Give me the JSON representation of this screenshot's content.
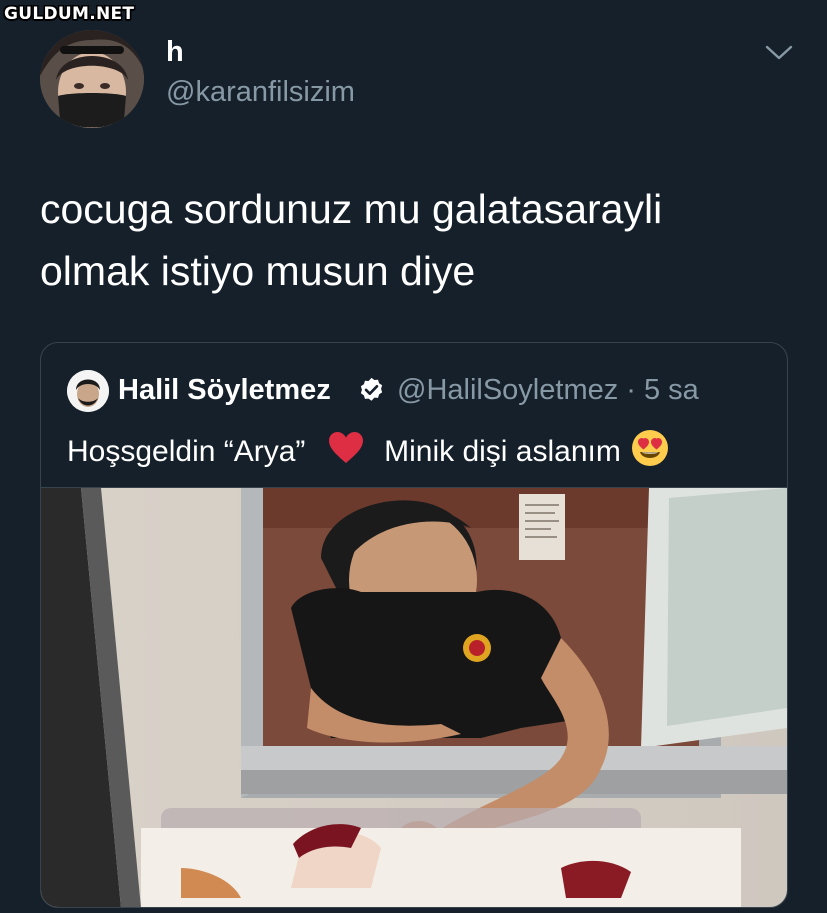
{
  "watermark": "GULDUM.NET",
  "author": {
    "display_name": "h",
    "handle": "@karanfilsizim"
  },
  "icons": {
    "menu": "chevron-down-icon",
    "verified": "verified-badge-icon",
    "heart": "red-heart-emoji",
    "face": "heart-eyes-emoji"
  },
  "tweet": {
    "text": "cocuga sordunuz mu galatasarayli\nolmak istiyo musun diye"
  },
  "quoted_tweet": {
    "display_name": "Halil Söyletmez",
    "handle_time": "@HalilSoyletmez · 5 sa",
    "text_part1": "Hoşsgeldin “Arya”",
    "text_part2": "Minik dişi aslanım"
  },
  "colors": {
    "background": "#15202b",
    "secondary_text": "#8899a6",
    "border": "#38444d",
    "verified": "#ffffff"
  }
}
